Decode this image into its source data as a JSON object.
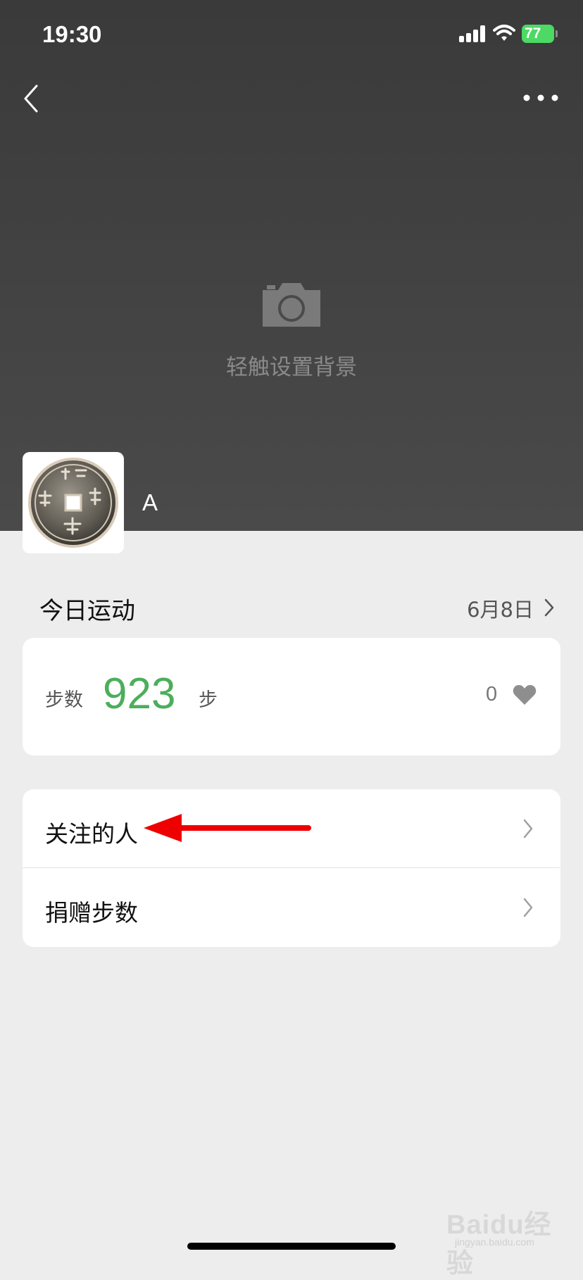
{
  "status_bar": {
    "time": "19:30",
    "battery": "77"
  },
  "header": {
    "set_background_label": "轻触设置背景",
    "username": "A"
  },
  "today": {
    "title": "今日运动",
    "date": "6月8日"
  },
  "steps_card": {
    "label": "步数",
    "value": "923",
    "unit": "步",
    "likes": "0"
  },
  "menu": {
    "items": [
      {
        "label": "关注的人"
      },
      {
        "label": "捐赠步数"
      }
    ]
  },
  "watermark": {
    "text": "Baidu经验",
    "sub": "jingyan.baidu.com"
  },
  "colors": {
    "header_bg": "#444444",
    "page_bg": "#ededed",
    "steps_green": "#4cae5b",
    "battery_green": "#4cd964",
    "annotation_arrow": "#ee0000"
  },
  "icons": [
    "back-chevron-icon",
    "more-dots-icon",
    "camera-icon",
    "chevron-right-icon",
    "heart-icon",
    "cellular-signal-icon",
    "wifi-icon",
    "battery-icon"
  ]
}
